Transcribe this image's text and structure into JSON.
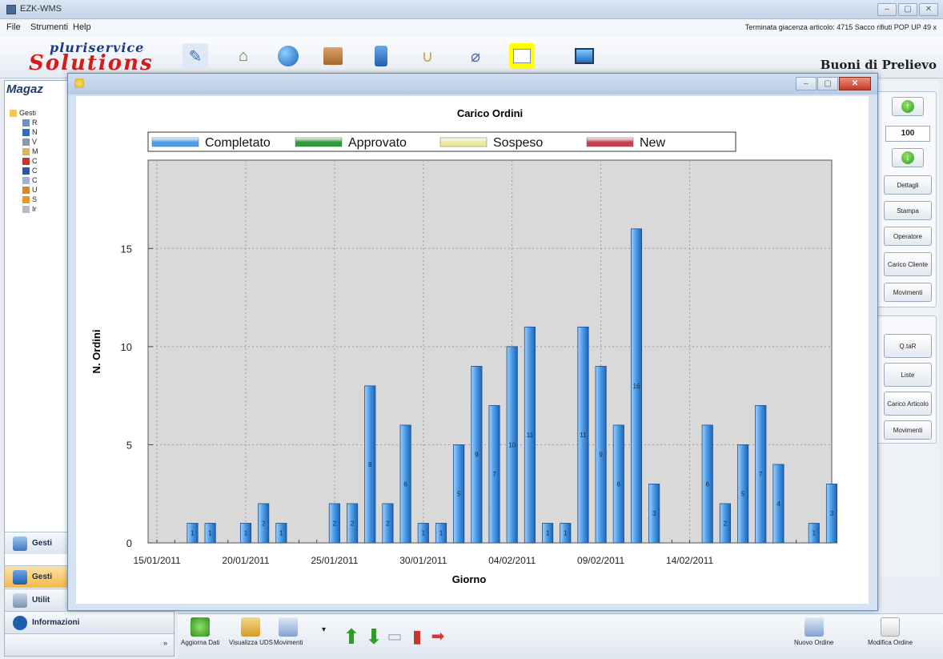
{
  "window": {
    "title": "EZK-WMS",
    "controls": [
      "–",
      "▢",
      "✕"
    ]
  },
  "menu": {
    "items": [
      "File",
      "Strumenti",
      "Help"
    ],
    "status_message": "Terminata giacenza articolo: 4715 Sacco rifiuti POP UP 49 x"
  },
  "toolbar": {
    "logo_top": "pluriservice",
    "logo_bottom": "Solutions",
    "section_title": "Buoni di Prelievo",
    "icons": [
      "edit-document-icon",
      "home-refresh-icon",
      "globe-icon",
      "box-icon",
      "phone-icon",
      "rope-icon",
      "stapler-icon",
      "package-open-icon",
      "monitor-icon"
    ]
  },
  "left_panel": {
    "title": "Magaz",
    "tree": [
      {
        "label": "Gesti",
        "level": 0
      },
      {
        "label": "R",
        "level": 1
      },
      {
        "label": "N",
        "level": 1
      },
      {
        "label": "V",
        "level": 1
      },
      {
        "label": "M",
        "level": 1
      },
      {
        "label": "C",
        "level": 1
      },
      {
        "label": "C",
        "level": 1
      },
      {
        "label": "C",
        "level": 1
      },
      {
        "label": "U",
        "level": 1
      },
      {
        "label": "S",
        "level": 1
      },
      {
        "label": "Ir",
        "level": 1
      }
    ],
    "nav": [
      {
        "label": "Gesti",
        "active": false
      },
      {
        "label": "Gesti",
        "active": true
      },
      {
        "label": "Utilit",
        "active": false
      },
      {
        "label": "Informazioni",
        "active": false
      }
    ],
    "more": "»"
  },
  "right_panel": {
    "quantity_value": "100",
    "buttons_top": [
      "Dettagli",
      "Stampa",
      "Operatore",
      "Carico Cliente",
      "Movimenti"
    ],
    "buttons_bottom": [
      "Q.taR",
      "Liste",
      "Carico Articolo",
      "Movimenti"
    ]
  },
  "bottom_bar": {
    "left_buttons": [
      "Aggiorna Dati",
      "Visualizza UDS",
      "Movimenti"
    ],
    "right_buttons": [
      "Nuovo Ordine",
      "Modifica Ordine"
    ]
  },
  "chart_data": {
    "type": "bar",
    "title": "Carico Ordini",
    "xlabel": "Giorno",
    "ylabel": "N. Ordini",
    "ylim": [
      0,
      19.5
    ],
    "yticks": [
      0,
      5,
      10,
      15
    ],
    "xtick_labels": [
      "15/01/2011",
      "20/01/2011",
      "25/01/2011",
      "30/01/2011",
      "04/02/2011",
      "09/02/2011",
      "14/02/2011"
    ],
    "legend": [
      "Completato",
      "Approvato",
      "Sospeso",
      "New"
    ],
    "legend_colors": [
      "#4d9de8",
      "#2e9a3a",
      "#ede8a0",
      "#c8404e"
    ],
    "grid": true,
    "day_start": "15/01/2011",
    "series": [
      {
        "name": "Completato",
        "days": [
          2,
          3,
          5,
          6,
          7,
          10,
          11,
          12,
          13,
          14,
          15,
          16,
          17,
          18,
          19,
          20,
          21,
          22,
          23,
          24,
          25,
          26,
          27,
          28,
          29,
          31,
          32,
          33,
          34,
          35,
          36,
          37,
          38
        ],
        "values": [
          1,
          1,
          1,
          2,
          1,
          2,
          2,
          8,
          2,
          6,
          1,
          1,
          5,
          9,
          7,
          10,
          11,
          1,
          1,
          11,
          9,
          6,
          16,
          3,
          0,
          6,
          2,
          5,
          7,
          4,
          0,
          1,
          3
        ]
      }
    ],
    "background": "#d9d9d9"
  }
}
